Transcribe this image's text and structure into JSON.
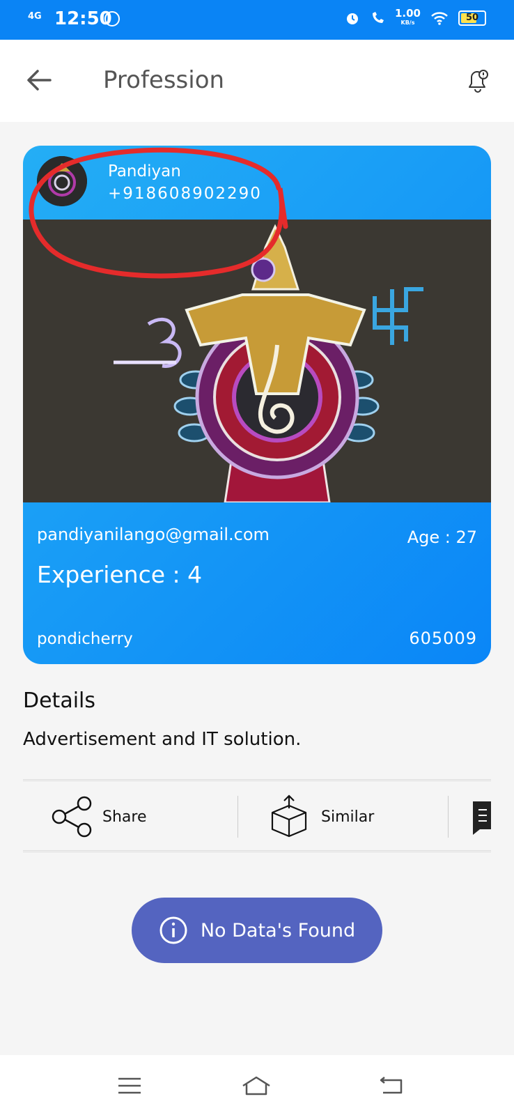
{
  "status_bar": {
    "network": "4G",
    "time": "12:50",
    "speed_value": "1.00",
    "speed_unit": "KB/s",
    "battery": "50"
  },
  "app_bar": {
    "title": "Profession"
  },
  "profile": {
    "name": "Pandiyan",
    "phone": "+918608902290",
    "email": "pandiyanilango@gmail.com",
    "age_label": "Age : 27",
    "experience_label": "Experience : 4",
    "city": "pondicherry",
    "pincode": "605009"
  },
  "details": {
    "heading": "Details",
    "text": "Advertisement and IT solution."
  },
  "actions": {
    "share_label": "Share",
    "similar_label": "Similar"
  },
  "notice": {
    "text": "No Data's Found"
  },
  "colors": {
    "status_bar": "#0a84f5",
    "card_gradient_start": "#24aef5",
    "card_gradient_end": "#0a86f7",
    "notice_bg": "#5464c0",
    "annotation_red": "#e52b2b"
  }
}
